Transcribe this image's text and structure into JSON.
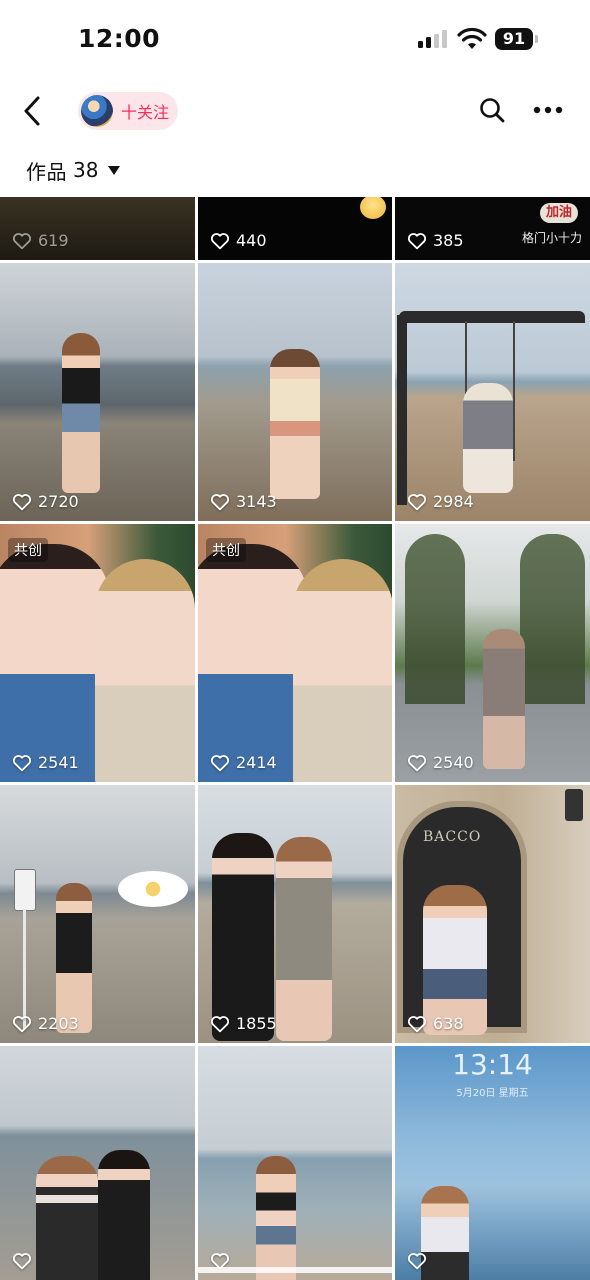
{
  "status_bar": {
    "time": "12:00",
    "battery": "91"
  },
  "nav": {
    "follow_label": "十关注"
  },
  "works": {
    "label": "作品",
    "count": "38"
  },
  "tiles": [
    {
      "likes": "619"
    },
    {
      "likes": "440"
    },
    {
      "likes": "385",
      "overlay": "加油",
      "caption": "格门小十力"
    },
    {
      "likes": "2720"
    },
    {
      "likes": "3143"
    },
    {
      "likes": "2984"
    },
    {
      "likes": "2541",
      "badge": "共创"
    },
    {
      "likes": "2414",
      "badge": "共创"
    },
    {
      "likes": "2540"
    },
    {
      "likes": "2203"
    },
    {
      "likes": "1855"
    },
    {
      "likes": "638",
      "sign": "BACCO"
    },
    {
      "likes": ""
    },
    {
      "likes": ""
    },
    {
      "likes": "",
      "overlay_time": "13:14",
      "overlay_date": "5月20日 星期五"
    }
  ]
}
